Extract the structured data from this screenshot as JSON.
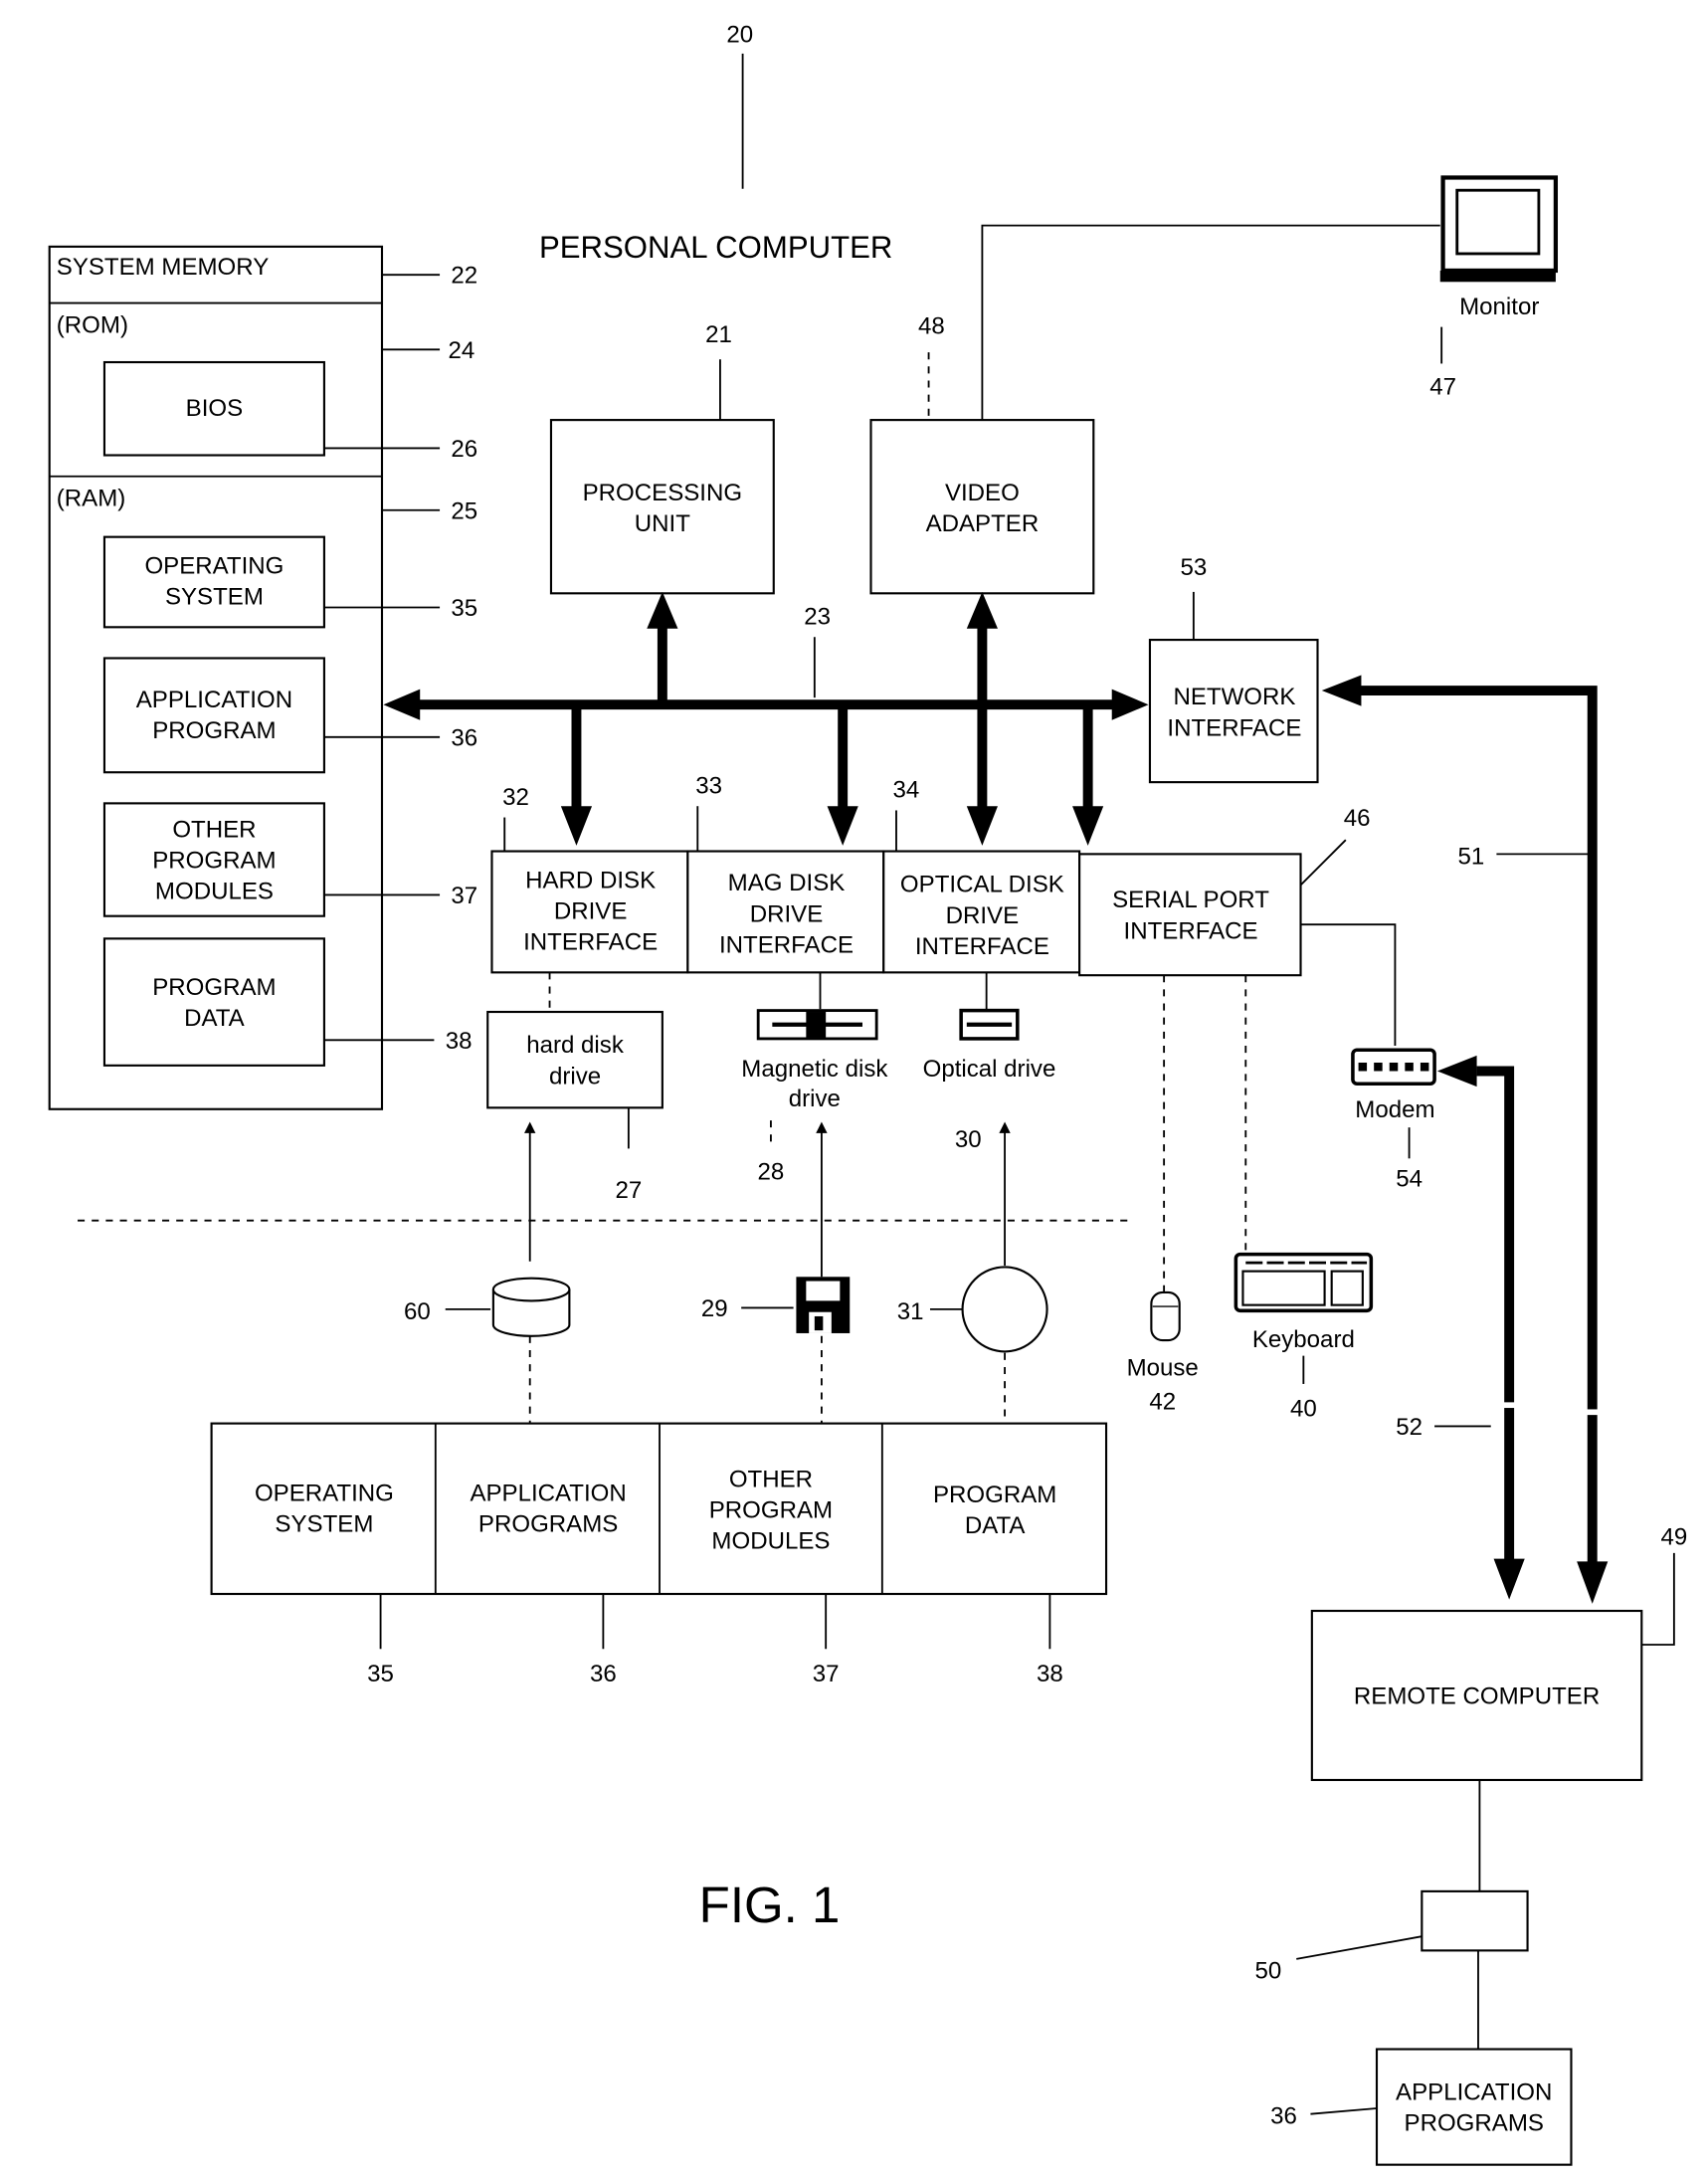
{
  "figure": {
    "ref": "20",
    "title": "PERSONAL COMPUTER",
    "caption": "FIG. 1"
  },
  "system_memory": {
    "label": "SYSTEM MEMORY",
    "ref": "22",
    "rom": {
      "label": "(ROM)",
      "ref": "24"
    },
    "bios": {
      "label": "BIOS",
      "ref": "26"
    },
    "ram": {
      "label": "(RAM)",
      "ref": "25"
    },
    "items": [
      {
        "lines": [
          "OPERATING",
          "SYSTEM"
        ],
        "ref": "35"
      },
      {
        "lines": [
          "APPLICATION",
          "PROGRAM"
        ],
        "ref": "36"
      },
      {
        "lines": [
          "OTHER",
          "PROGRAM",
          "MODULES"
        ],
        "ref": "37"
      },
      {
        "lines": [
          "PROGRAM",
          "DATA"
        ],
        "ref": "38"
      }
    ]
  },
  "processing_unit": {
    "lines": [
      "PROCESSING",
      "UNIT"
    ],
    "ref": "21"
  },
  "video_adapter": {
    "lines": [
      "VIDEO",
      "ADAPTER"
    ],
    "ref": "48"
  },
  "monitor": {
    "label": "Monitor",
    "ref": "47"
  },
  "bus": {
    "ref": "23"
  },
  "network_interface": {
    "lines": [
      "NETWORK",
      "INTERFACE"
    ],
    "ref": "53"
  },
  "interfaces": [
    {
      "lines": [
        "HARD DISK",
        "DRIVE",
        "INTERFACE"
      ],
      "ref": "32"
    },
    {
      "lines": [
        "MAG DISK",
        "DRIVE",
        "INTERFACE"
      ],
      "ref": "33"
    },
    {
      "lines": [
        "OPTICAL DISK",
        "DRIVE",
        "INTERFACE"
      ],
      "ref": "34"
    },
    {
      "lines": [
        "SERIAL PORT",
        "INTERFACE"
      ],
      "ref": "46"
    }
  ],
  "drives": {
    "hard_disk": {
      "lines": [
        "hard disk",
        "drive"
      ],
      "ref": "27"
    },
    "magnetic": {
      "lines": [
        "Magnetic disk",
        "drive"
      ],
      "ref": "28"
    },
    "optical": {
      "label": "Optical drive",
      "ref": "30"
    }
  },
  "media": {
    "disk_stack": {
      "ref": "60"
    },
    "floppy": {
      "ref": "29"
    },
    "optical_disc": {
      "ref": "31"
    }
  },
  "peripherals": {
    "mouse": {
      "label": "Mouse",
      "ref": "42"
    },
    "keyboard": {
      "label": "Keyboard",
      "ref": "40"
    },
    "modem": {
      "label": "Modem",
      "ref": "54"
    }
  },
  "links": {
    "wan": "52",
    "lan": "51"
  },
  "storage_contents": [
    {
      "lines": [
        "OPERATING",
        "SYSTEM"
      ],
      "ref": "35"
    },
    {
      "lines": [
        "APPLICATION",
        "PROGRAMS"
      ],
      "ref": "36"
    },
    {
      "lines": [
        "OTHER",
        "PROGRAM",
        "MODULES"
      ],
      "ref": "37"
    },
    {
      "lines": [
        "PROGRAM",
        "DATA"
      ],
      "ref": "38"
    }
  ],
  "remote_computer": {
    "label": "REMOTE COMPUTER",
    "ref": "49"
  },
  "remote_storage": {
    "ref": "50"
  },
  "remote_apps": {
    "lines": [
      "APPLICATION",
      "PROGRAMS"
    ],
    "ref": "36"
  }
}
